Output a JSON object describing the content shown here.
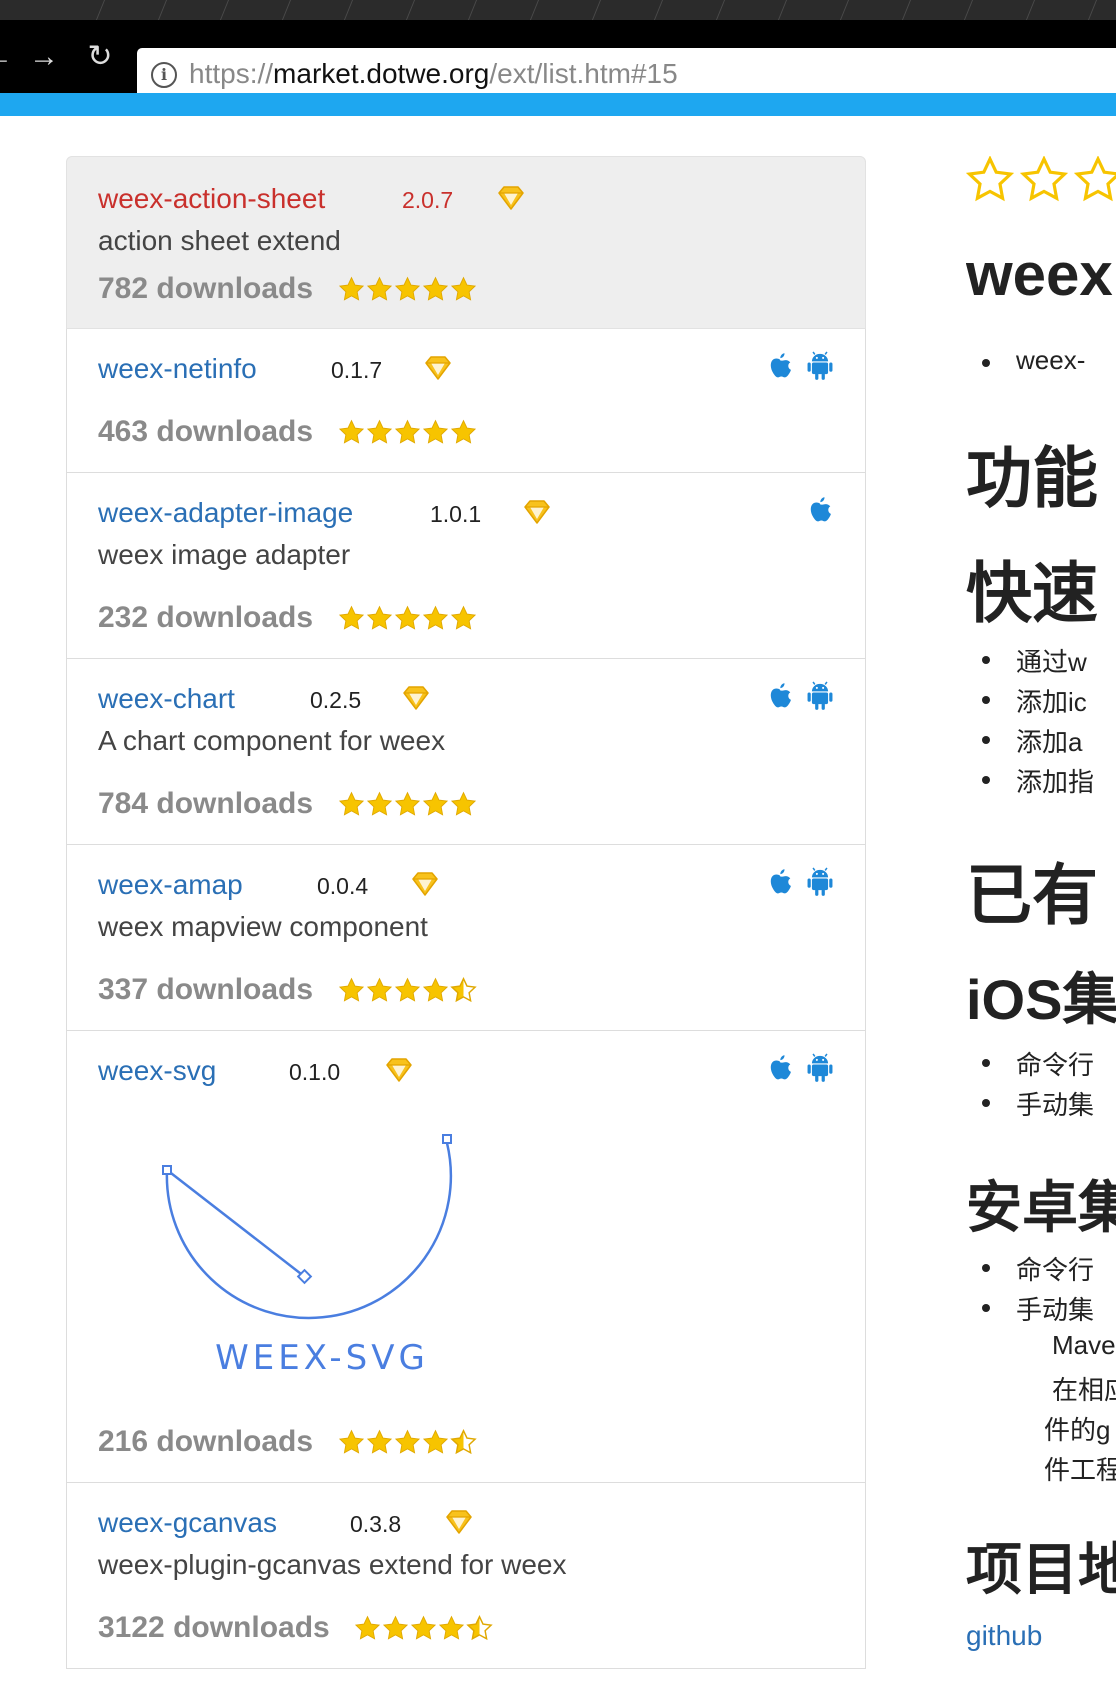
{
  "browser": {
    "url_prefix": "https://",
    "url_host": "market.dotwe.org",
    "url_path": "/ext/list.htm#15",
    "back_icon": "arrow-left-icon",
    "forward_icon": "arrow-right-icon",
    "reload_icon": "reload-icon",
    "info_icon": "info-icon"
  },
  "colors": {
    "accent": "#1ea7f0",
    "active_link": "#c9302c",
    "link": "#2a6fb5",
    "star": "#f7c400",
    "platform": "#1e88d8"
  },
  "extensions": [
    {
      "name": "weex-action-sheet",
      "version": "2.0.7",
      "description": "action sheet extend",
      "downloads": "782 downloads",
      "rating": 5,
      "platforms": [],
      "active": true
    },
    {
      "name": "weex-netinfo",
      "version": "0.1.7",
      "description": "",
      "downloads": "463 downloads",
      "rating": 5,
      "platforms": [
        "ios",
        "android"
      ]
    },
    {
      "name": "weex-adapter-image",
      "version": "1.0.1",
      "description": "weex image adapter",
      "downloads": "232 downloads",
      "rating": 5,
      "platforms": [
        "ios"
      ]
    },
    {
      "name": "weex-chart",
      "version": "0.2.5",
      "description": "A chart component for weex",
      "downloads": "784 downloads",
      "rating": 5,
      "platforms": [
        "ios",
        "android"
      ]
    },
    {
      "name": "weex-amap",
      "version": "0.0.4",
      "description": "weex mapview component",
      "downloads": "337 downloads",
      "rating": 4.5,
      "platforms": [
        "ios",
        "android"
      ]
    },
    {
      "name": "weex-svg",
      "version": "0.1.0",
      "description": "",
      "logo_text": "WEEX-SVG",
      "downloads": "216 downloads",
      "rating": 4.5,
      "platforms": [
        "ios",
        "android"
      ]
    },
    {
      "name": "weex-gcanvas",
      "version": "0.3.8",
      "description": "weex-plugin-gcanvas extend for weex",
      "downloads": "3122 downloads",
      "rating": 4.5,
      "platforms": []
    }
  ],
  "detail": {
    "title": "weex",
    "bullet_1": "weex-",
    "h_features": "功能",
    "h_quickstart": "快速",
    "steps": [
      "通过w",
      "添加ic",
      "添加a",
      "添加指"
    ],
    "h_existing": "已有",
    "h_ios": "iOS集",
    "ios_items": [
      "命令行",
      "手动集"
    ],
    "h_android": "安卓集",
    "android_items": [
      "命令行",
      "手动集"
    ],
    "android_text": [
      "Mave",
      "在相应",
      "件的g",
      "件工程"
    ],
    "h_project": "项目地",
    "link": "github"
  }
}
